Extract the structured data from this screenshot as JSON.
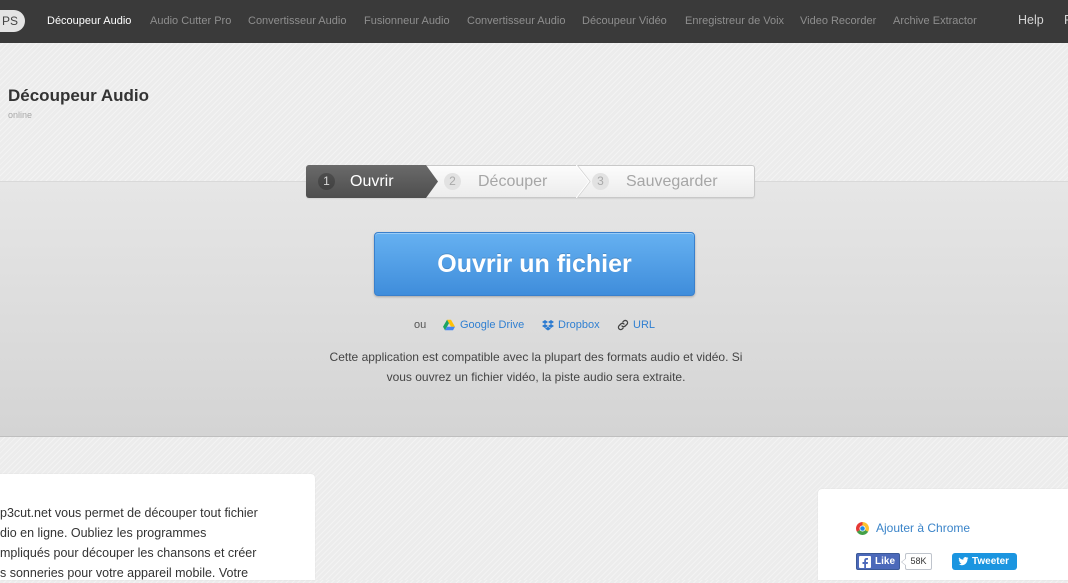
{
  "nav": {
    "logo": "PS",
    "items": [
      {
        "label": "Découpeur Audio",
        "active": true
      },
      {
        "label": "Audio Cutter Pro",
        "active": false
      },
      {
        "label": "Convertisseur Audio",
        "active": false
      },
      {
        "label": "Fusionneur Audio",
        "active": false
      },
      {
        "label": "Convertisseur Audio",
        "active": false
      },
      {
        "label": "Découpeur Vidéo",
        "active": false
      },
      {
        "label": "Enregistreur de Voix",
        "active": false
      },
      {
        "label": "Video Recorder",
        "active": false
      },
      {
        "label": "Archive Extractor",
        "active": false
      }
    ],
    "help": "Help",
    "partial_item": "F"
  },
  "header": {
    "title": "Découpeur Audio",
    "subtitle": "online"
  },
  "steps": [
    {
      "number": "1",
      "label": "Ouvrir",
      "state": "active"
    },
    {
      "number": "2",
      "label": "Découper",
      "state": "inactive"
    },
    {
      "number": "3",
      "label": "Sauvegarder",
      "state": "inactive"
    }
  ],
  "open_button": {
    "label": "Ouvrir un fichier"
  },
  "sources": {
    "or_label": "ou",
    "links": [
      {
        "label": "Google Drive",
        "icon": "google-drive-icon"
      },
      {
        "label": "Dropbox",
        "icon": "dropbox-icon"
      },
      {
        "label": "URL",
        "icon": "link-icon"
      }
    ]
  },
  "description": {
    "line1": "Cette application est compatible avec la plupart des formats audio et vidéo. Si",
    "line2": "vous ouvrez un fichier vidéo, la piste audio sera extraite."
  },
  "about_card": {
    "lines": [
      "p3cut.net vous permet de découper tout fichier",
      "dio en ligne. Oubliez les programmes",
      "mpliqués pour découper les chansons et créer",
      "s sonneries pour votre appareil mobile. Votre"
    ]
  },
  "side_card": {
    "chrome_link": "Ajouter à Chrome",
    "chrome_icon": "chrome-icon",
    "facebook": {
      "label": "Like",
      "count": "58K",
      "icon": "facebook-icon"
    },
    "twitter": {
      "label": "Tweeter",
      "icon": "twitter-bird-icon"
    }
  },
  "colors": {
    "nav_bg": "#3a3a3a",
    "accent": "#3f8ddb",
    "link": "#2f7fd1",
    "facebook": "#4c69ba",
    "twitter": "#1b95e0"
  }
}
